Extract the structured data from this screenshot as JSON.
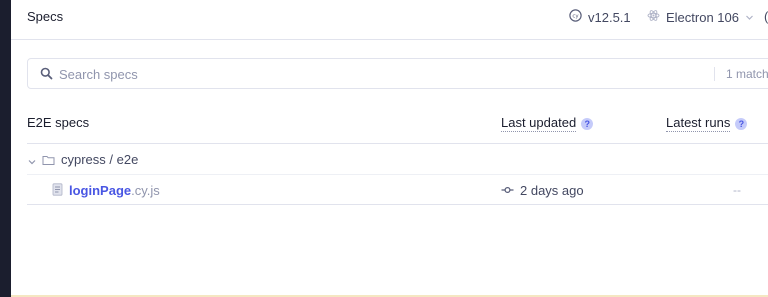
{
  "header": {
    "title": "Specs",
    "version": "v12.5.1",
    "browser": "Electron 106",
    "edge_glyph": "("
  },
  "search": {
    "placeholder": "Search specs",
    "value": "",
    "match_count": "1 match"
  },
  "table": {
    "columns": {
      "specs": "E2E specs",
      "last_updated": "Last updated",
      "latest_runs": "Latest runs",
      "help": "?"
    },
    "folder": {
      "label": "cypress / e2e"
    },
    "rows": [
      {
        "file_base": "loginPage",
        "file_ext": ".cy.js",
        "last_updated": "2 days ago",
        "latest_runs": "--"
      }
    ]
  },
  "colors": {
    "accent": "#4956e3",
    "muted": "#9095ad",
    "border": "#e1e3ed",
    "sidebar": "#1b1e2e"
  },
  "icons": {
    "version": "cypress-logo-icon",
    "browser": "electron-icon",
    "search": "search-icon",
    "folder_toggle": "chevron-down-icon",
    "folder": "folder-icon",
    "file": "document-icon",
    "commit": "git-commit-icon",
    "help": "help-icon"
  }
}
